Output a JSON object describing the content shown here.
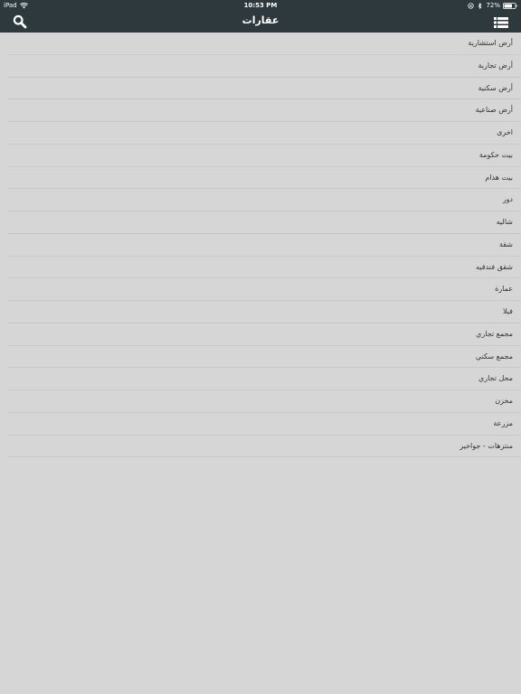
{
  "status_bar": {
    "device": "iPad",
    "time": "10:53 PM",
    "battery": "72%"
  },
  "nav": {
    "title": "عقارات",
    "search_icon": "search-icon",
    "menu_icon": "list-menu-icon"
  },
  "categories": [
    "أرض استشارية",
    "أرض تجارية",
    "أرض سكنية",
    "أرض صناعية",
    "اخرى",
    "بيت حكومة",
    "بيت هدام",
    "دور",
    "شاليه",
    "شقة",
    "شقق فندقيه",
    "عمارة",
    "فيلا",
    "مجمع تجاري",
    "مجمع سكني",
    "محل تجاري",
    "مخزن",
    "مزرعة",
    "منتزهات - جواخير"
  ],
  "colors": {
    "header_bg": "#2d393c",
    "list_bg": "#d6d6d6",
    "divider": "#c9c9c9",
    "text": "#333333"
  }
}
